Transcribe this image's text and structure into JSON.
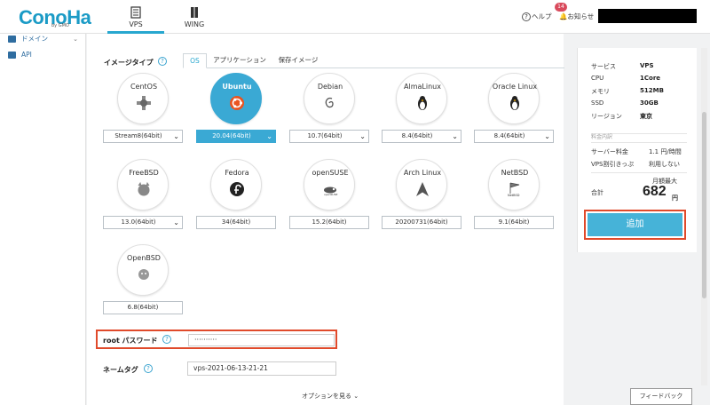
{
  "header": {
    "logo": "ConoHa",
    "logo_sub": "by GMO",
    "tabs": [
      {
        "label": "VPS"
      },
      {
        "label": "WING"
      }
    ],
    "help": "ヘルプ",
    "notice": "お知らせ",
    "notice_count": "14"
  },
  "sidebar": {
    "items": [
      {
        "label": "ドメイン"
      },
      {
        "label": "API"
      }
    ]
  },
  "image_type": {
    "label": "イメージタイプ",
    "tabs": [
      {
        "label": "OS"
      },
      {
        "label": "アプリケーション"
      },
      {
        "label": "保存イメージ"
      }
    ],
    "os": [
      {
        "name": "CentOS",
        "version": "Stream8(64bit)",
        "icon": "centos-icon",
        "selected": false,
        "has_dropdown": true
      },
      {
        "name": "Ubuntu",
        "version": "20.04(64bit)",
        "icon": "ubuntu-icon",
        "selected": true,
        "has_dropdown": true
      },
      {
        "name": "Debian",
        "version": "10.7(64bit)",
        "icon": "debian-icon",
        "selected": false,
        "has_dropdown": true
      },
      {
        "name": "AlmaLinux",
        "version": "8.4(64bit)",
        "icon": "tux-icon",
        "selected": false,
        "has_dropdown": true
      },
      {
        "name": "Oracle Linux",
        "version": "8.4(64bit)",
        "icon": "tux-icon",
        "selected": false,
        "has_dropdown": true
      },
      {
        "name": "FreeBSD",
        "version": "13.0(64bit)",
        "icon": "freebsd-icon",
        "selected": false,
        "has_dropdown": true
      },
      {
        "name": "Fedora",
        "version": "34(64bit)",
        "icon": "fedora-icon",
        "selected": false,
        "has_dropdown": false
      },
      {
        "name": "openSUSE",
        "version": "15.2(64bit)",
        "icon": "opensuse-icon",
        "selected": false,
        "has_dropdown": false
      },
      {
        "name": "Arch Linux",
        "version": "20200731(64bit)",
        "icon": "arch-icon",
        "selected": false,
        "has_dropdown": false
      },
      {
        "name": "NetBSD",
        "version": "9.1(64bit)",
        "icon": "netbsd-icon",
        "selected": false,
        "has_dropdown": false
      },
      {
        "name": "OpenBSD",
        "version": "6.8(64bit)",
        "icon": "openbsd-icon",
        "selected": false,
        "has_dropdown": false
      }
    ]
  },
  "root_password": {
    "label": "root パスワード",
    "value": "··········"
  },
  "name_tag": {
    "label": "ネームタグ",
    "value": "vps-2021-06-13-21-21"
  },
  "options_link": "オプションを見る",
  "summary": {
    "rows": [
      {
        "key": "サービス",
        "value": "VPS"
      },
      {
        "key": "CPU",
        "value": "1Core"
      },
      {
        "key": "メモリ",
        "value": "512MB"
      },
      {
        "key": "SSD",
        "value": "30GB"
      },
      {
        "key": "リージョン",
        "value": "東京"
      }
    ],
    "price_section": "料金内訳",
    "server_fee_label": "サーバー料金",
    "server_fee_value": "1.1 円/時間",
    "discount_label": "VPS割引きっぷ",
    "discount_value": "利用しない",
    "monthly_max": "月額最大",
    "total_label": "合計",
    "total_value": "682",
    "total_unit": "円",
    "add_button": "追加"
  },
  "feedback": "フィードバック",
  "colors": {
    "accent": "#27a7cf",
    "highlight": "#e04a2b",
    "selected_bg": "#3aa9d4"
  }
}
